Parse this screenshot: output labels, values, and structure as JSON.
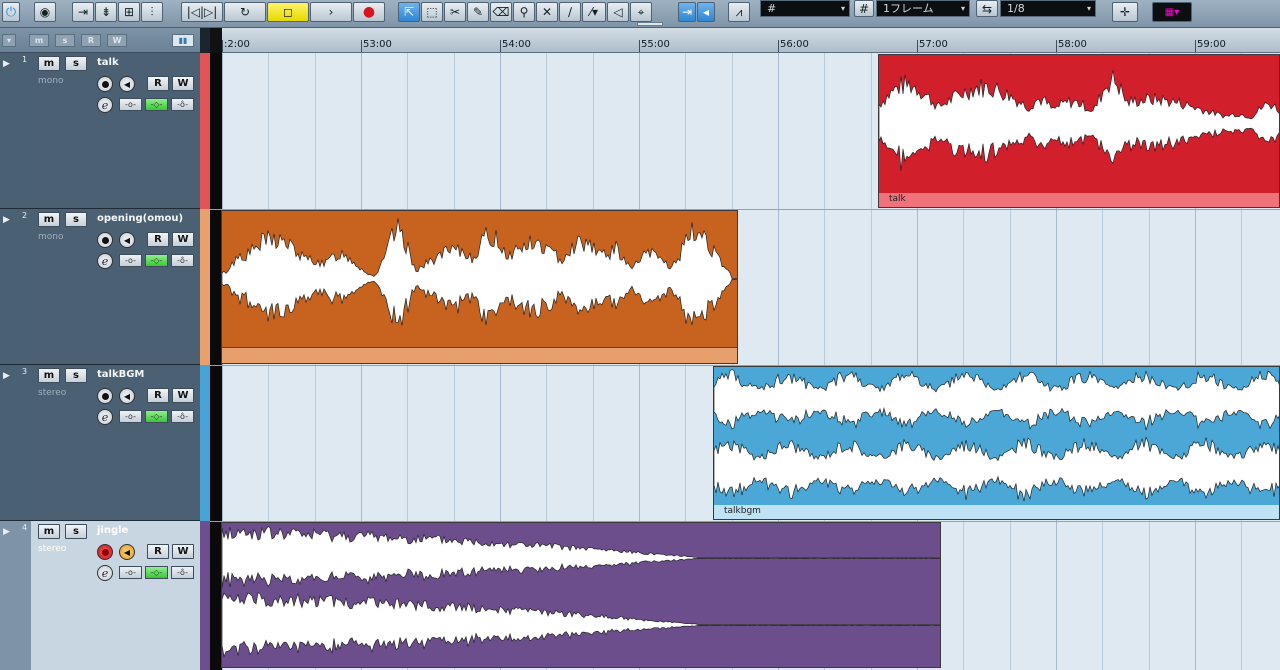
{
  "toolbar": {
    "grid_icon": "grid-icon",
    "quantize_label": "1フレーム",
    "quantize_value": "1/8",
    "colors": {
      "bg": "#8ea3b5",
      "active_yellow": "#f2e600",
      "record_red": "#d8141e",
      "blue": "#2f8fd9"
    }
  },
  "ruler": {
    "labels": [
      ":2:00",
      "53:00",
      "54:00",
      "55:00",
      "56:00",
      "57:00",
      "58:00",
      "59:00"
    ]
  },
  "tracks": [
    {
      "number": "1",
      "name": "talk",
      "type": "mono",
      "mute": "m",
      "solo": "s",
      "read": "R",
      "write": "W",
      "color": "#e05555",
      "event_label": "talk",
      "event_color": "#d21f2c"
    },
    {
      "number": "2",
      "name": "opening(omou)",
      "type": "mono",
      "mute": "m",
      "solo": "s",
      "read": "R",
      "write": "W",
      "color": "#e8a16c",
      "event_label": "",
      "event_color": "#c8621f"
    },
    {
      "number": "3",
      "name": "talkBGM",
      "type": "stereo",
      "mute": "m",
      "solo": "s",
      "read": "R",
      "write": "W",
      "color": "#4aa3d6",
      "event_label": "talkbgm",
      "event_color": "#4aa7d6"
    },
    {
      "number": "4",
      "name": "jingle",
      "type": "stereo",
      "mute": "m",
      "solo": "s",
      "read": "R",
      "write": "W",
      "color": "#6b4f8e",
      "event_label": "",
      "event_color": "#6b4e8b"
    }
  ],
  "header_filters": [
    "m",
    "s",
    "R",
    "W"
  ]
}
